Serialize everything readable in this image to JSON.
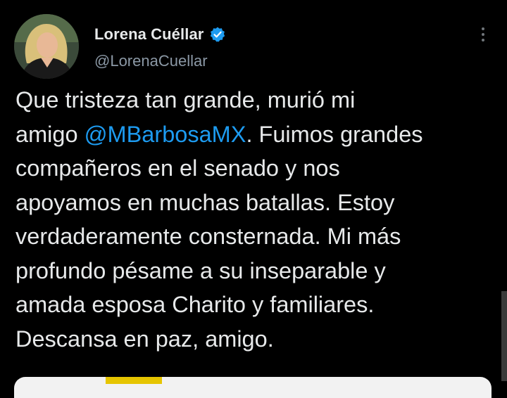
{
  "author": {
    "display_name": "Lorena Cuéllar",
    "handle": "@LorenaCuellar",
    "verified": true
  },
  "tweet": {
    "lines": [
      {
        "text": "Que tristeza tan grande, murió mi"
      },
      {
        "before": "amigo ",
        "mention": "@MBarbosaMX",
        "after": ". Fuimos grandes"
      },
      {
        "text": "compañeros en el senado y nos"
      },
      {
        "text": "apoyamos en muchas batallas. Estoy"
      },
      {
        "text": "verdaderamente consternada. Mi más"
      },
      {
        "text": "profundo pésame a su inseparable y"
      },
      {
        "text": "amada esposa Charito y familiares."
      },
      {
        "text": "Descansa en paz, amigo."
      }
    ]
  },
  "icons": {
    "verified": "verified-badge-icon",
    "more": "more-options-icon"
  },
  "colors": {
    "background": "#000000",
    "text": "#e7e9ea",
    "secondary_text": "#8b98a5",
    "accent": "#1d9bf0"
  }
}
